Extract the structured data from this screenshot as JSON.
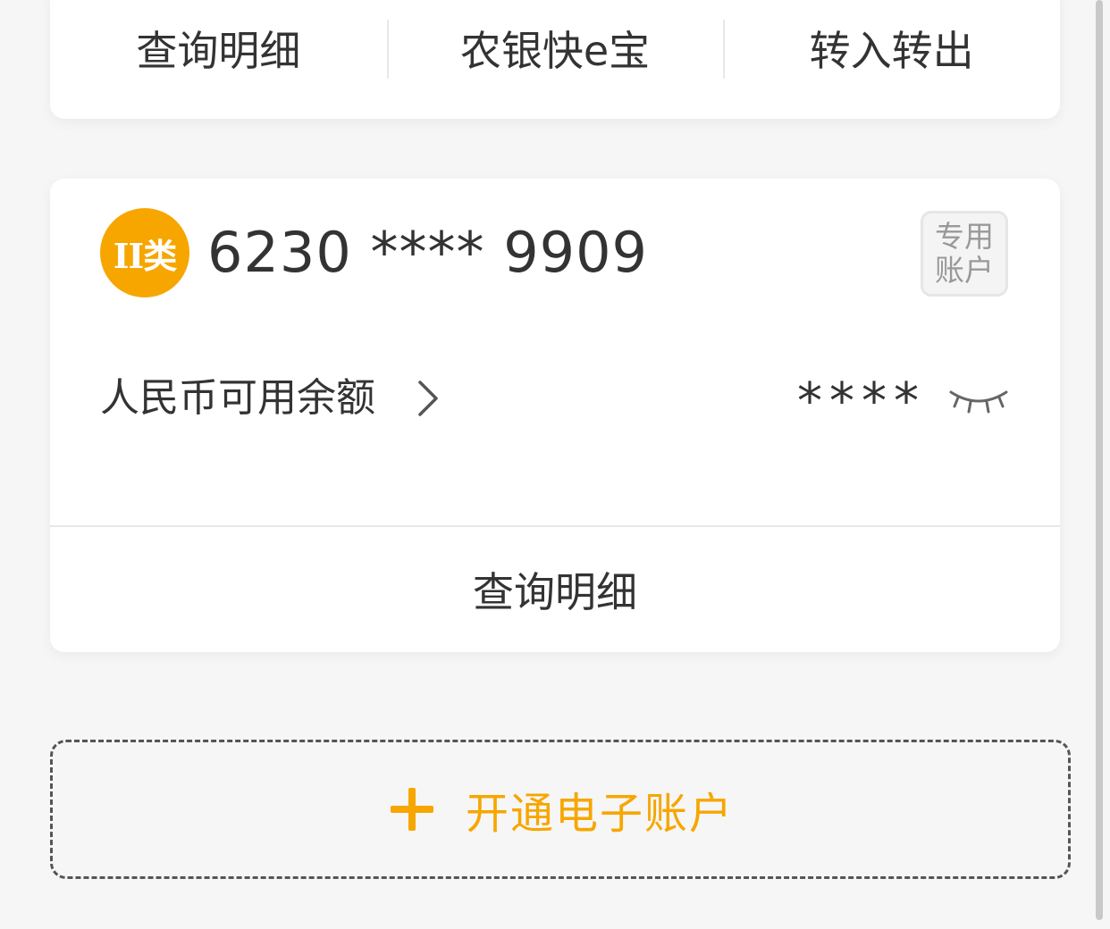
{
  "top_actions": [
    "查询明细",
    "农银快e宝",
    "转入转出"
  ],
  "account": {
    "badge": "II类",
    "number": "6230 **** 9909",
    "tag_line1": "专用",
    "tag_line2": "账户",
    "balance_label": "人民币可用余额",
    "balance_masked": "****",
    "detail_button": "查询明细"
  },
  "open_account": {
    "label": "开通电子账户"
  },
  "colors": {
    "accent": "#f7a600",
    "background": "#f6f6f6",
    "text": "#333333",
    "divider": "#e8e8e8"
  },
  "icons": {
    "chevron": "chevron-right-icon",
    "eye": "eye-closed-icon",
    "plus": "plus-icon"
  }
}
